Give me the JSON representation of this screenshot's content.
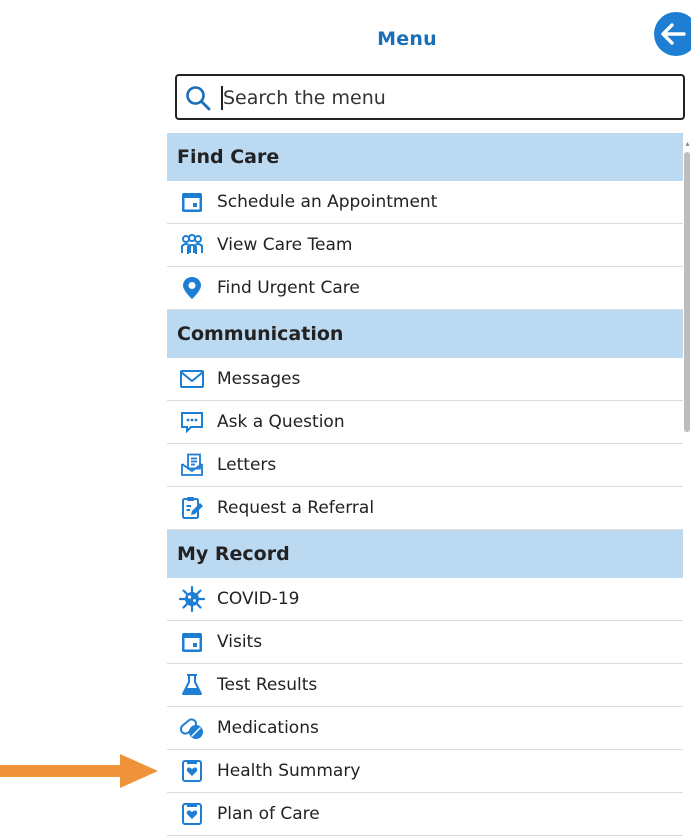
{
  "header": {
    "title": "Menu"
  },
  "search": {
    "placeholder": "Search the menu"
  },
  "sections": [
    {
      "label": "Find Care",
      "items": [
        {
          "label": "Schedule an Appointment",
          "icon": "calendar-icon"
        },
        {
          "label": "View Care Team",
          "icon": "care-team-icon"
        },
        {
          "label": "Find Urgent Care",
          "icon": "location-pin-icon"
        }
      ]
    },
    {
      "label": "Communication",
      "items": [
        {
          "label": "Messages",
          "icon": "envelope-icon"
        },
        {
          "label": "Ask a Question",
          "icon": "chat-bubble-icon"
        },
        {
          "label": "Letters",
          "icon": "letters-icon"
        },
        {
          "label": "Request a Referral",
          "icon": "referral-clipboard-icon"
        }
      ]
    },
    {
      "label": "My Record",
      "items": [
        {
          "label": "COVID-19",
          "icon": "virus-icon"
        },
        {
          "label": "Visits",
          "icon": "calendar-icon"
        },
        {
          "label": "Test Results",
          "icon": "flask-icon"
        },
        {
          "label": "Medications",
          "icon": "pills-icon"
        },
        {
          "label": "Health Summary",
          "icon": "health-summary-icon"
        },
        {
          "label": "Plan of Care",
          "icon": "plan-of-care-icon"
        }
      ]
    }
  ],
  "colors": {
    "accent": "#1a6fb8",
    "back_button": "#1e7ed4",
    "section_header_bg": "#bcd9f2",
    "annotation_arrow": "#f0923a"
  }
}
